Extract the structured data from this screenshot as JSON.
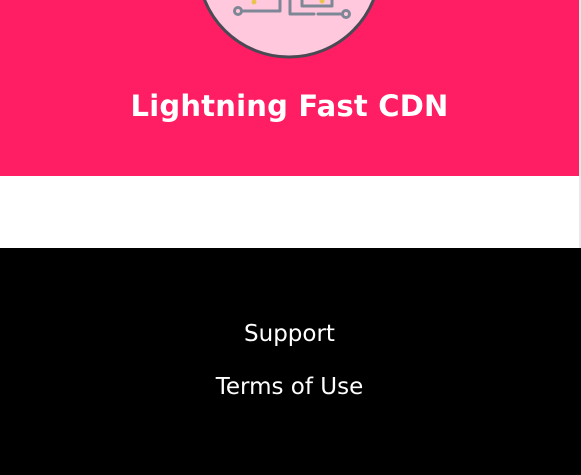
{
  "feature": {
    "title": "Lightning Fast CDN",
    "icon": "circuit-icon",
    "background_color": "#ff1d63",
    "icon_bg_color": "#ffc8dc"
  },
  "footer": {
    "background_color": "#000000",
    "links": [
      {
        "label": "Support"
      },
      {
        "label": "Terms of Use"
      }
    ]
  }
}
